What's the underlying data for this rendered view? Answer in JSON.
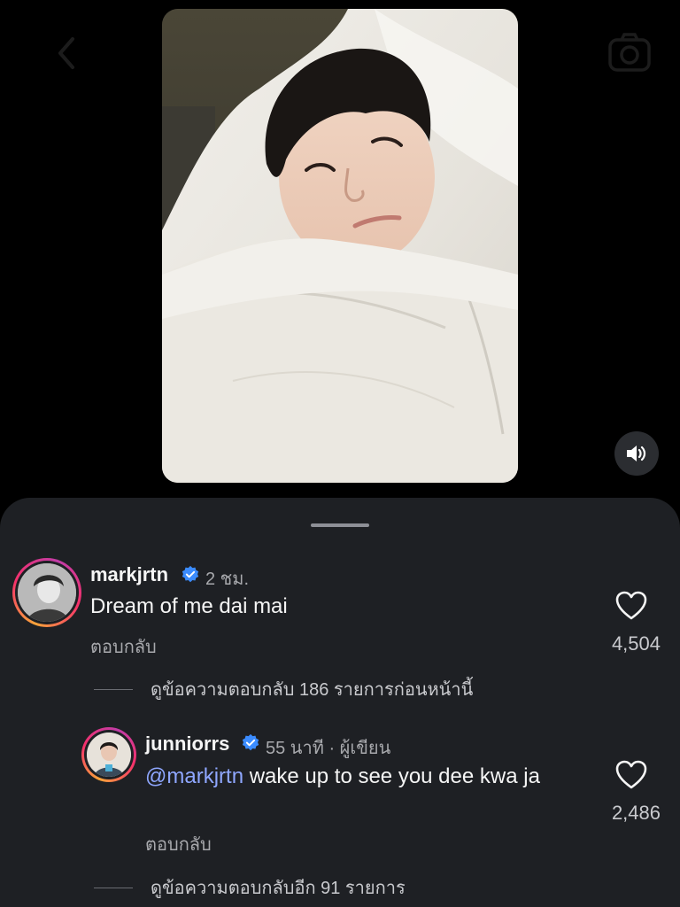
{
  "top_bar": {
    "back_icon": "chevron-left-icon",
    "camera_icon": "camera-icon"
  },
  "media": {
    "sound_icon": "speaker-volume-icon"
  },
  "comments": [
    {
      "username": "markjrtn",
      "verified": true,
      "time": "2 ชม.",
      "text": "Dream of me dai mai",
      "reply_label": "ตอบกลับ",
      "likes": "4,504",
      "view_replies": "ดูข้อความตอบกลับ 186 รายการก่อนหน้านี้"
    },
    {
      "username": "junniorrs",
      "verified": true,
      "time": "55 นาที · ผู้เขียน",
      "mention": "@markjrtn",
      "text": " wake up to see you dee kwa ja",
      "reply_label": "ตอบกลับ",
      "likes": "2,486",
      "view_replies": "ดูข้อความตอบกลับอีก 91 รายการ"
    }
  ],
  "colors": {
    "background": "#000000",
    "sheet": "#1e2024",
    "verified": "#3b8cff",
    "mention": "#8fa7ff",
    "secondary_text": "#a8a9ad"
  }
}
